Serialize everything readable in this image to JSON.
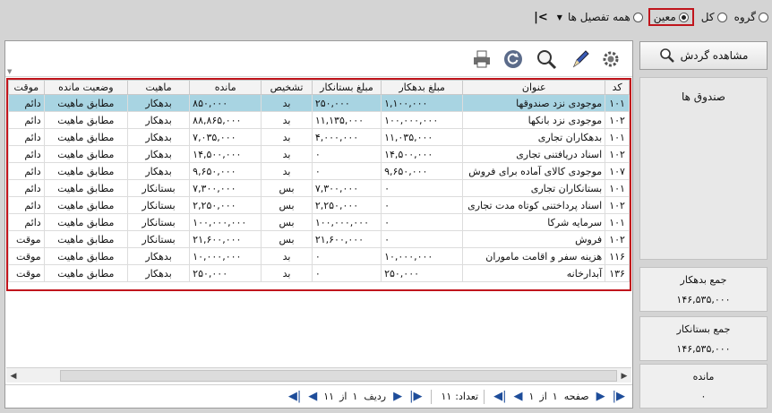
{
  "top_bar": {
    "radios": [
      {
        "label": "گروه",
        "checked": false
      },
      {
        "label": "کل",
        "checked": false
      },
      {
        "label": "معین",
        "checked": true
      },
      {
        "label": "همه تفصیل ها",
        "checked": false
      }
    ],
    "first_page_glyph": "|<"
  },
  "right_panel": {
    "view_button_label": "مشاهده گردش",
    "selected_account": "صندوق ها",
    "sums": [
      {
        "label": "جمع بدهکار",
        "value": "۱۴۶,۵۳۵,۰۰۰"
      },
      {
        "label": "جمع بستانکار",
        "value": "۱۴۶,۵۳۵,۰۰۰"
      },
      {
        "label": "مانده",
        "value": "۰"
      }
    ]
  },
  "toolbar": {
    "icons": [
      "settings-icon",
      "edit-pen-icon",
      "search-icon",
      "refresh-icon",
      "print-icon"
    ]
  },
  "grid": {
    "columns": [
      "کد",
      "عنوان",
      "مبلغ بدهکار",
      "مبلغ بستانکار",
      "تشخیص",
      "مانده",
      "ماهیت",
      "وضعیت مانده",
      "موقت"
    ],
    "rows": [
      [
        "۱۰۱",
        "موجودی نزد صندوقها",
        "۱,۱۰۰,۰۰۰",
        "۲۵۰,۰۰۰",
        "بد",
        "۸۵۰,۰۰۰",
        "بدهکار",
        "مطابق ماهیت",
        "دائم"
      ],
      [
        "۱۰۲",
        "موجودی نزد بانکها",
        "۱۰۰,۰۰۰,۰۰۰",
        "۱۱,۱۳۵,۰۰۰",
        "بد",
        "۸۸,۸۶۵,۰۰۰",
        "بدهکار",
        "مطابق ماهیت",
        "دائم"
      ],
      [
        "۱۰۱",
        "بدهکاران تجاری",
        "۱۱,۰۳۵,۰۰۰",
        "۴,۰۰۰,۰۰۰",
        "بد",
        "۷,۰۳۵,۰۰۰",
        "بدهکار",
        "مطابق ماهیت",
        "دائم"
      ],
      [
        "۱۰۲",
        "اسناد دریافتنی تجاری",
        "۱۴,۵۰۰,۰۰۰",
        "۰",
        "بد",
        "۱۴,۵۰۰,۰۰۰",
        "بدهکار",
        "مطابق ماهیت",
        "دائم"
      ],
      [
        "۱۰۷",
        "موجودی کالای آماده برای فروش",
        "۹,۶۵۰,۰۰۰",
        "۰",
        "بد",
        "۹,۶۵۰,۰۰۰",
        "بدهکار",
        "مطابق ماهیت",
        "دائم"
      ],
      [
        "۱۰۱",
        "بستانکاران تجاری",
        "۰",
        "۷,۳۰۰,۰۰۰",
        "بس",
        "۷,۳۰۰,۰۰۰",
        "بستانکار",
        "مطابق ماهیت",
        "دائم"
      ],
      [
        "۱۰۲",
        "اسناد پرداختنی کوتاه مدت تجاری",
        "۰",
        "۲,۲۵۰,۰۰۰",
        "بس",
        "۲,۲۵۰,۰۰۰",
        "بستانکار",
        "مطابق ماهیت",
        "دائم"
      ],
      [
        "۱۰۱",
        "سرمایه شرکا",
        "۰",
        "۱۰۰,۰۰۰,۰۰۰",
        "بس",
        "۱۰۰,۰۰۰,۰۰۰",
        "بستانکار",
        "مطابق ماهیت",
        "دائم"
      ],
      [
        "۱۰۲",
        "فروش",
        "۰",
        "۲۱,۶۰۰,۰۰۰",
        "بس",
        "۲۱,۶۰۰,۰۰۰",
        "بستانکار",
        "مطابق ماهیت",
        "موقت"
      ],
      [
        "۱۱۶",
        "هزینه سفر و اقامت ماموران",
        "۱۰,۰۰۰,۰۰۰",
        "۰",
        "بد",
        "۱۰,۰۰۰,۰۰۰",
        "بدهکار",
        "مطابق ماهیت",
        "موقت"
      ],
      [
        "۱۳۶",
        "آبدارخانه",
        "۲۵۰,۰۰۰",
        "۰",
        "بد",
        "۲۵۰,۰۰۰",
        "بدهکار",
        "مطابق ماهیت",
        "موقت"
      ]
    ],
    "selected_row": 0
  },
  "pager": {
    "row_label": "ردیف",
    "row_current": "۱",
    "row_of": "از",
    "row_total": "۱۱",
    "count_label": "تعداد:",
    "count_value": "۱۱",
    "page_label": "صفحه",
    "page_current": "۱",
    "page_of": "از",
    "page_total": "۱"
  }
}
